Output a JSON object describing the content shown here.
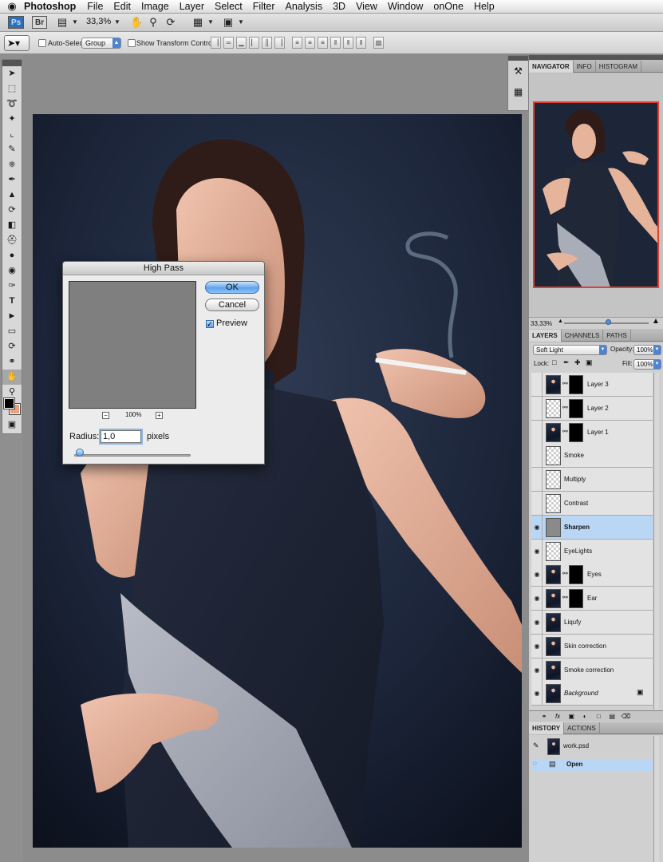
{
  "menubar": {
    "apple": "",
    "app": "Photoshop",
    "items": [
      "File",
      "Edit",
      "Image",
      "Layer",
      "Select",
      "Filter",
      "Analysis",
      "3D",
      "View",
      "Window",
      "onOne",
      "Help"
    ]
  },
  "appbar": {
    "ps": "Ps",
    "br": "Br",
    "zoom": "33,3%"
  },
  "options": {
    "auto_select_label": "Auto-Select:",
    "auto_select_value": "Group",
    "show_transform_label": "Show Transform Controls"
  },
  "dialog": {
    "title": "High Pass",
    "ok": "OK",
    "cancel": "Cancel",
    "preview_label": "Preview",
    "preview_checked": true,
    "zoom_minus": "−",
    "zoom_plus": "+",
    "zoom_pct": "100%",
    "radius_label": "Radius:",
    "radius_value": "1,0",
    "radius_unit": "pixels"
  },
  "navigator": {
    "tabs": [
      "NAVIGATOR",
      "INFO",
      "HISTOGRAM"
    ],
    "zoom": "33,33%"
  },
  "layers_panel": {
    "tabs": [
      "LAYERS",
      "CHANNELS",
      "PATHS"
    ],
    "blend_mode": "Soft Light",
    "opacity_label": "Opacity:",
    "opacity_value": "100%",
    "lock_label": "Lock:",
    "fill_label": "Fill:",
    "fill_value": "100%",
    "layers": [
      {
        "name": "Layer 3",
        "visible": false,
        "thumb": "portrait",
        "mask": true
      },
      {
        "name": "Layer 2",
        "visible": false,
        "thumb": "checker",
        "mask": true
      },
      {
        "name": "Layer 1",
        "visible": false,
        "thumb": "portrait",
        "mask": true
      },
      {
        "name": "Smoke",
        "visible": false,
        "thumb": "checker",
        "mask": false
      },
      {
        "name": "Multiply",
        "visible": false,
        "thumb": "checker",
        "mask": false
      },
      {
        "name": "Contrast",
        "visible": false,
        "thumb": "checker",
        "mask": false
      },
      {
        "name": "Sharpen",
        "visible": true,
        "thumb": "gray",
        "mask": false,
        "selected": true
      },
      {
        "name": "EyeLights",
        "visible": true,
        "thumb": "checker",
        "mask": false
      },
      {
        "name": "Eyes",
        "visible": true,
        "thumb": "portrait",
        "mask": true
      },
      {
        "name": "Ear",
        "visible": true,
        "thumb": "portrait",
        "mask": true
      },
      {
        "name": "Liqufy",
        "visible": true,
        "thumb": "portrait",
        "mask": false
      },
      {
        "name": "Skin correction",
        "visible": true,
        "thumb": "portrait",
        "mask": false
      },
      {
        "name": "Smoke correction",
        "visible": true,
        "thumb": "portrait",
        "mask": false
      },
      {
        "name": "Background",
        "visible": true,
        "thumb": "portrait",
        "mask": false,
        "locked": true
      }
    ]
  },
  "history_panel": {
    "tabs": [
      "HISTORY",
      "ACTIONS"
    ],
    "snapshot": "work.psd",
    "steps": [
      "Open"
    ]
  },
  "icons": {
    "apple": "apple-icon",
    "hand": "hand-icon",
    "zoom": "zoom-icon",
    "eye": "eye-icon",
    "lock": "lock-icon"
  },
  "colors": {
    "foreground": "#000000",
    "background": "#e9a27d",
    "selection": "#b9d6f4",
    "navigator_frame": "#e2402f"
  }
}
